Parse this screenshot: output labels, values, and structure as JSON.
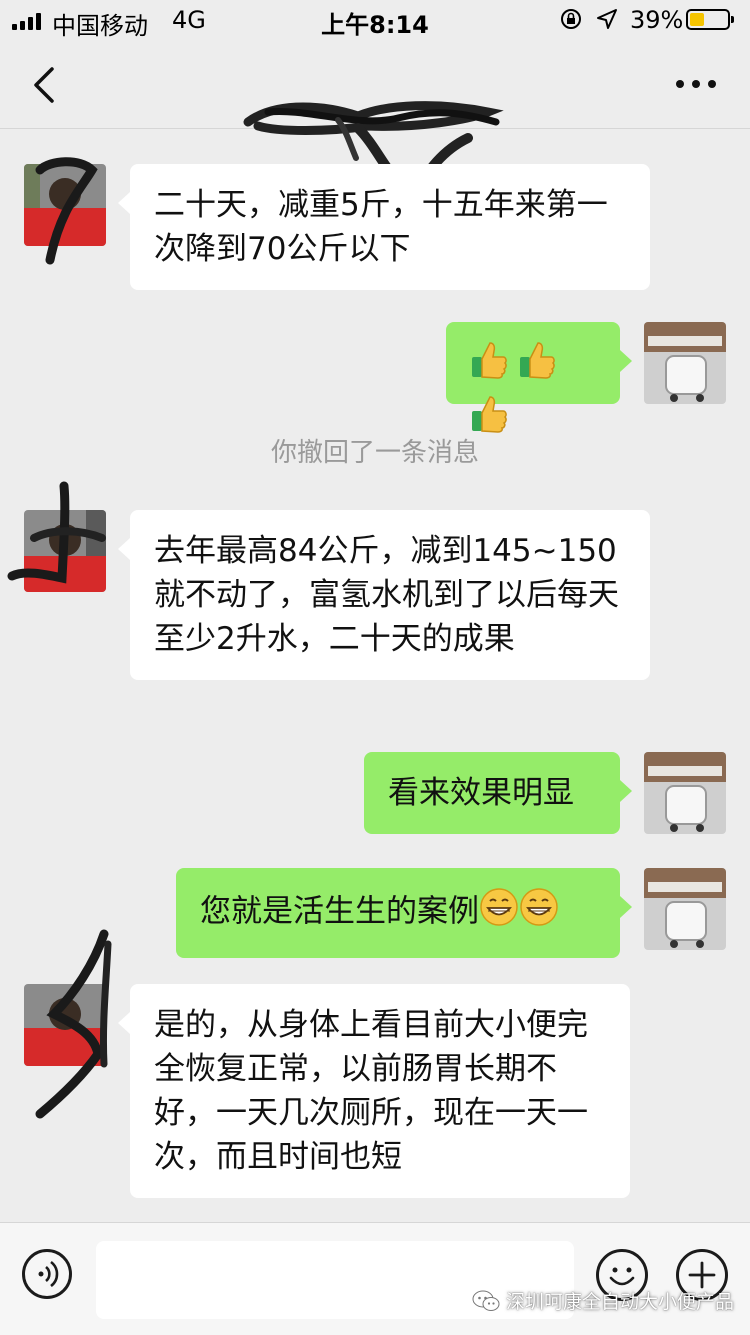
{
  "status_bar": {
    "carrier": "中国移动",
    "network": "4G",
    "time": "上午8:14",
    "battery_percent": "39%",
    "battery_level": 0.39,
    "battery_color": "#f5c400"
  },
  "nav": {
    "title": "",
    "back_icon": "chevron-left-icon",
    "more_icon": "more-dots-icon"
  },
  "messages": [
    {
      "side": "left",
      "text": "二十天，减重5斤，十五年来第一次降到70公斤以下"
    },
    {
      "side": "right",
      "text": "",
      "emoji": [
        "thumbs-up",
        "thumbs-up",
        "thumbs-up"
      ]
    },
    {
      "side": "left",
      "text": "去年最高84公斤，减到145~150就不动了，富氢水机到了以后每天至少2升水，二十天的成果"
    },
    {
      "side": "right",
      "text": "看来效果明显"
    },
    {
      "side": "right",
      "text": "您就是活生生的案例",
      "emoji": [
        "grin",
        "grin"
      ]
    },
    {
      "side": "left",
      "text": "是的，从身体上看目前大小便完全恢复正常，以前肠胃长期不好，一天几次厕所，现在一天一次，而且时间也短"
    }
  ],
  "system_message": "你撤回了一条消息",
  "input_bar": {
    "voice_icon": "voice-icon",
    "input_value": "",
    "emoji_icon": "smiley-icon",
    "plus_icon": "plus-icon"
  },
  "watermark": {
    "icon": "wechat-icon",
    "text": "深圳呵康全自动大小便产品"
  },
  "colors": {
    "background": "#ededed",
    "bubble_self": "#95ec69",
    "bubble_other": "#ffffff",
    "system_text": "#9a9a9a"
  }
}
